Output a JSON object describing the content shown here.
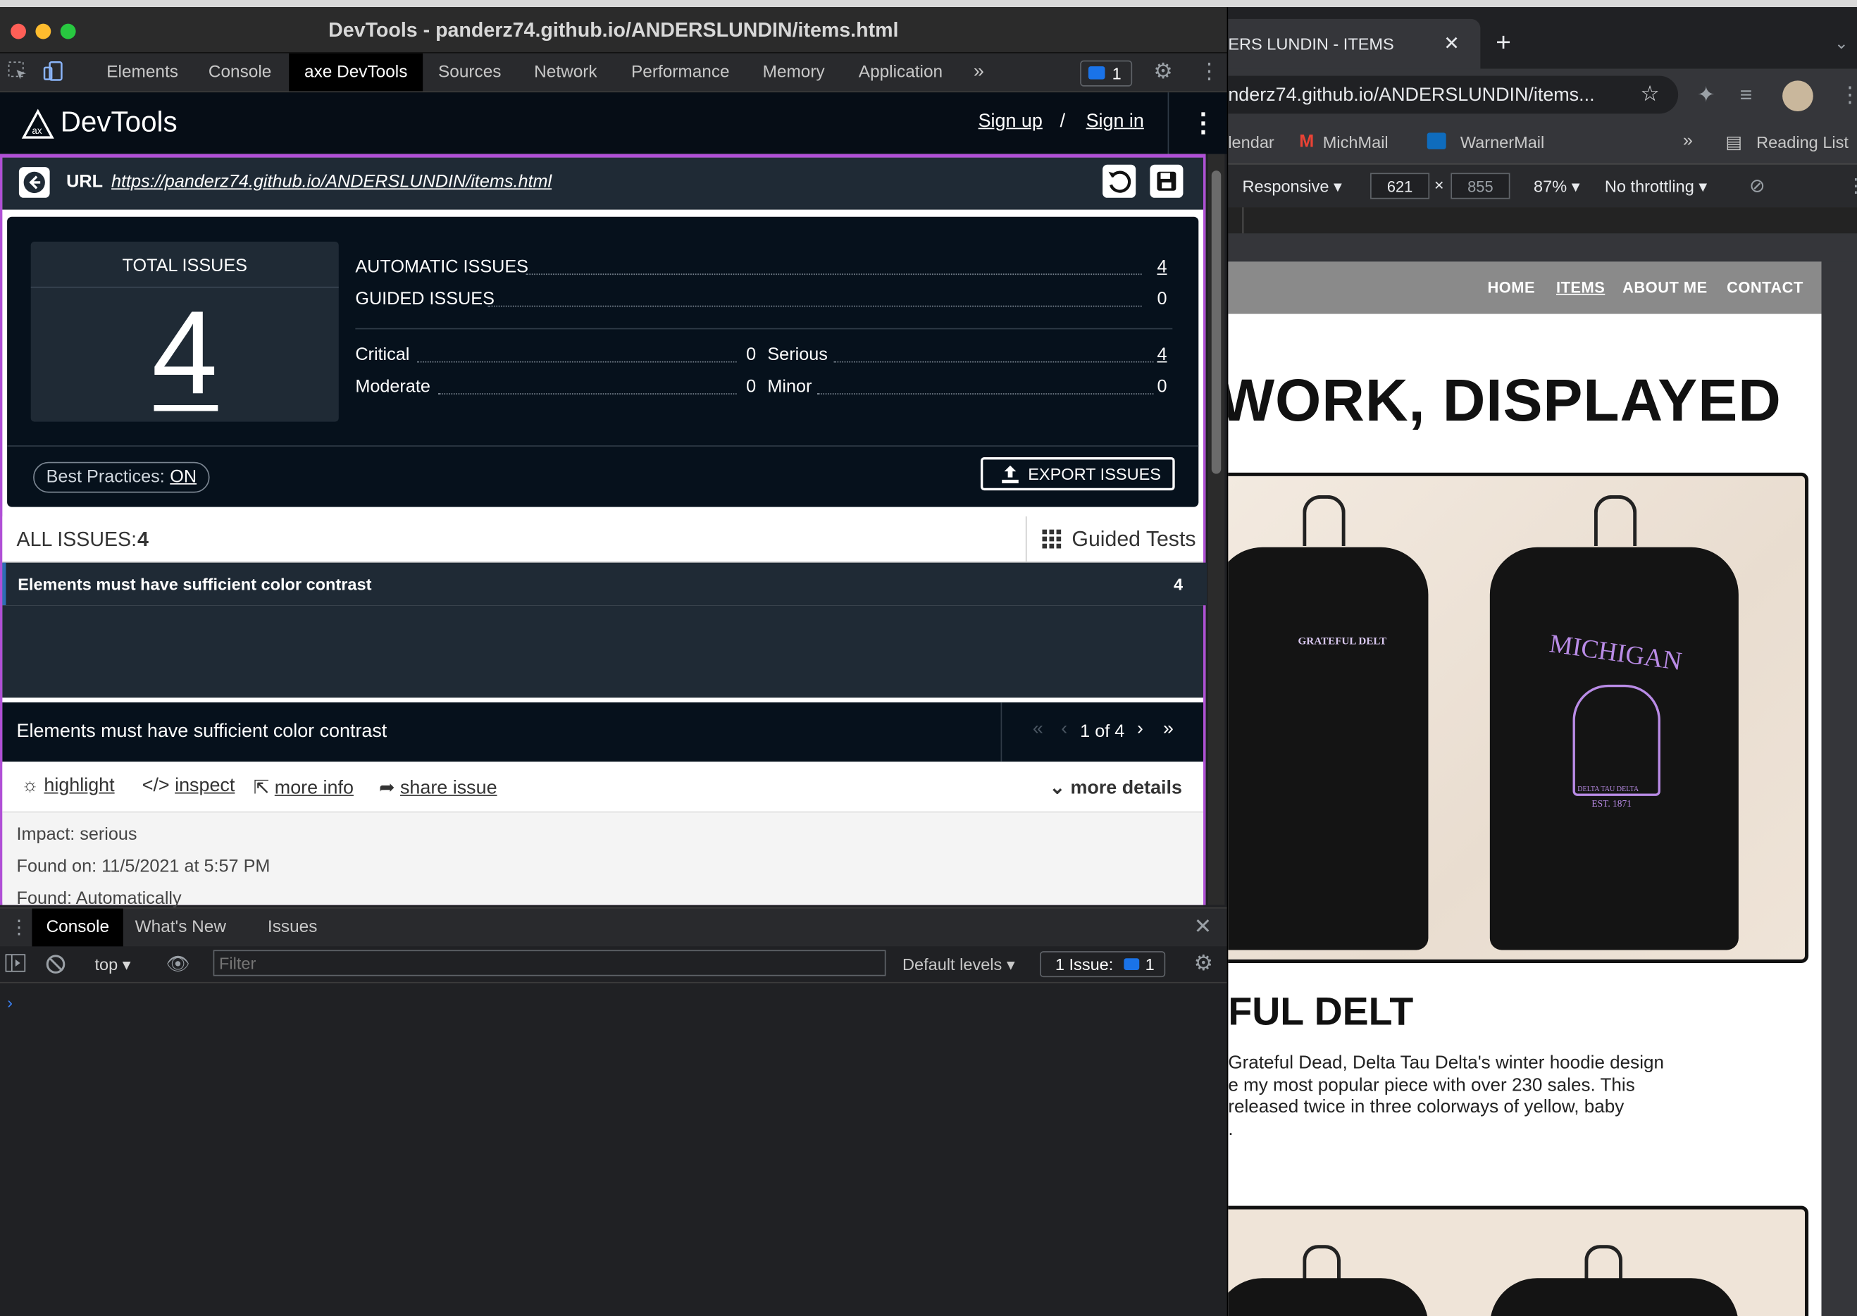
{
  "devtools": {
    "window_title": "DevTools - panderz74.github.io/ANDERSLUNDIN/items.html",
    "tabs": [
      "Elements",
      "Console",
      "axe DevTools",
      "Sources",
      "Network",
      "Performance",
      "Memory",
      "Application"
    ],
    "issues_badge": "1"
  },
  "axe": {
    "logo_text": "DevTools",
    "sign_up": "Sign up",
    "separator": "/",
    "sign_in": "Sign in",
    "url_label": "URL",
    "url": "https://panderz74.github.io/ANDERSLUNDIN/items.html",
    "total_issues_label": "TOTAL ISSUES",
    "total_issues": "4",
    "automatic_label": "AUTOMATIC ISSUES",
    "automatic_value": "4",
    "guided_label": "GUIDED ISSUES",
    "guided_value": "0",
    "critical_label": "Critical",
    "critical_value": "0",
    "serious_label": "Serious",
    "serious_value": "4",
    "moderate_label": "Moderate",
    "moderate_value": "0",
    "minor_label": "Minor",
    "minor_value": "0",
    "best_practices_label": "Best Practices:",
    "best_practices_value": "ON",
    "export_label": "EXPORT ISSUES",
    "all_issues_label": "ALL ISSUES:",
    "all_issues_count": "4",
    "guided_tests_label": "Guided Tests",
    "issue_title": "Elements must have sufficient color contrast",
    "issue_count": "4",
    "detail_title": "Elements must have sufficient color contrast",
    "pager": "1 of 4",
    "actions": {
      "highlight": "highlight",
      "inspect": "inspect",
      "more_info": "more info",
      "share": "share issue",
      "more_details": "more details"
    },
    "impact_label": "Impact:",
    "impact_value": "serious",
    "found_on_label": "Found on:",
    "found_on_value": "11/5/2021 at 5:57 PM",
    "found_label": "Found:",
    "found_value": "Automatically"
  },
  "drawer": {
    "tabs": [
      "Console",
      "What's New",
      "Issues"
    ],
    "context": "top",
    "filter_placeholder": "Filter",
    "levels": "Default levels",
    "issue_label": "1 Issue:",
    "issue_count": "1"
  },
  "browser": {
    "tab_title": "ERS LUNDIN - ITEMS",
    "address": "nderz74.github.io/ANDERSLUNDIN/items...",
    "bookmarks": [
      "lendar",
      "MichMail",
      "WarnerMail"
    ],
    "reading_list": "Reading List",
    "responsive": "Responsive",
    "width": "621",
    "height": "855",
    "zoom": "87%",
    "throttle": "No throttling"
  },
  "site": {
    "nav": [
      "HOME",
      "ITEMS",
      "ABOUT ME",
      "CONTACT"
    ],
    "heading": "WORK, DISPLAYED",
    "item_title": "FUL DELT",
    "hoodie_front_text": "GRATEFUL DELT",
    "hoodie_back_text": "MICHIGAN",
    "hoodie_back_sub": "DELTA TAU DELTA",
    "hoodie_back_est": "EST. 1871",
    "desc_lines": [
      " Grateful Dead, Delta Tau Delta's winter hoodie design",
      "e my most popular piece with over 230 sales. This",
      " released twice in three colorways of yellow, baby",
      "."
    ]
  },
  "colors": {
    "accent": "#b04fd6",
    "axe_dark": "#06111c",
    "axe_panel": "#1f2a35",
    "link_blue": "#2d6db5"
  }
}
